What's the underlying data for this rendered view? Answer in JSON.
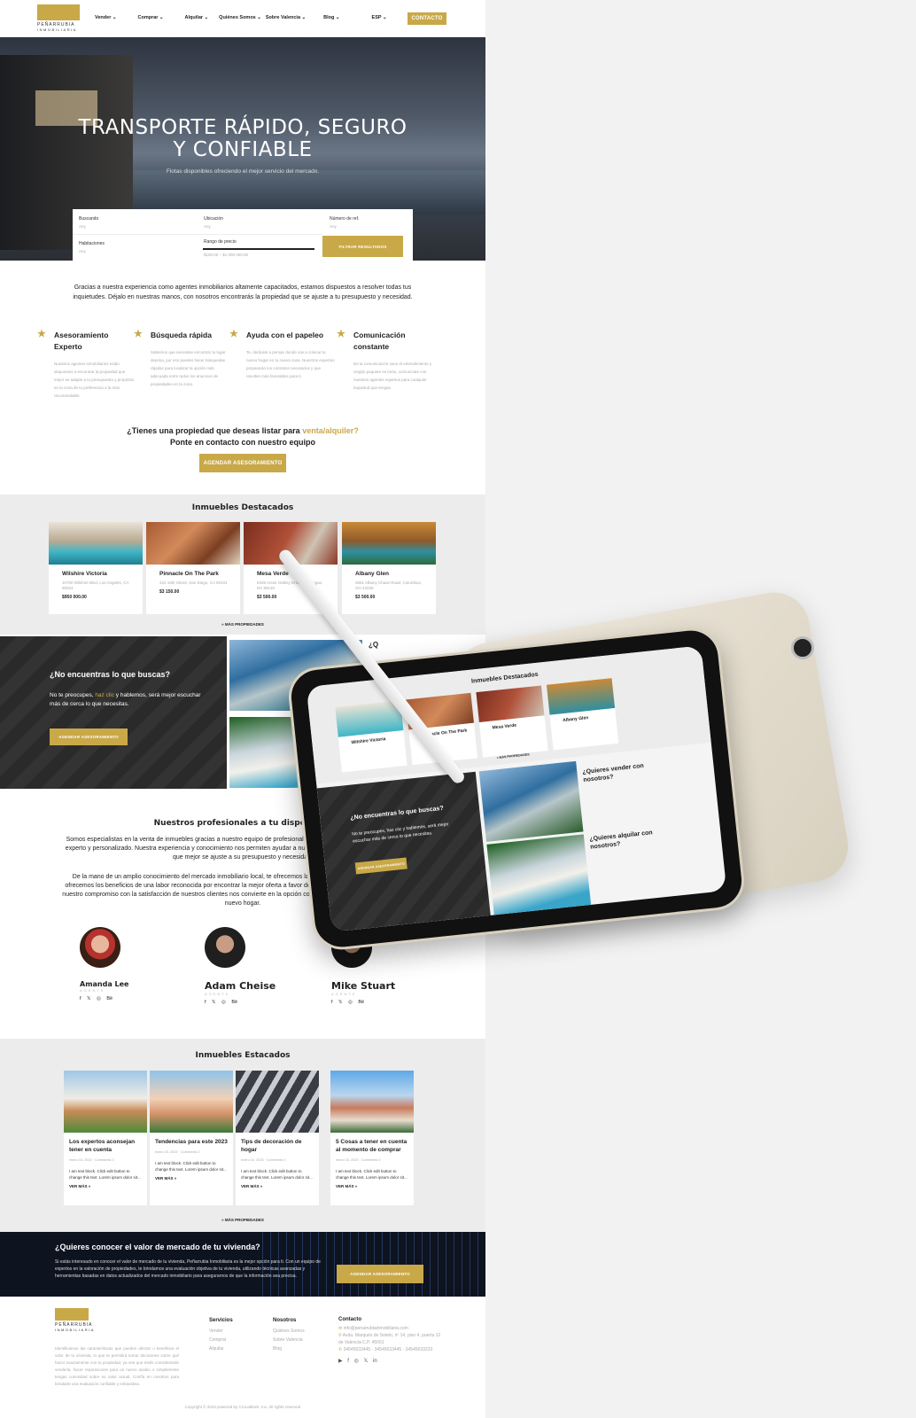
{
  "nav": {
    "logo_line1": "PEÑARRUBIA",
    "logo_line2": "INMOBILIARIA",
    "items": [
      "Vender ⌄",
      "Comprar ⌄",
      "Alquilar ⌄",
      "Quiénes Somos ⌄",
      "Sobre Valencia ⌄",
      "Blog ⌄",
      "ESP ⌄"
    ],
    "contact": "CONTACTO"
  },
  "hero": {
    "title_line1": "TRANSPORTE RÁPIDO, SEGURO",
    "title_line2": "Y CONFIABLE",
    "subtitle": "Flotas disponibles ofreciendo el mejor servicio del mercado."
  },
  "search": {
    "f1_label": "Buscando",
    "f1_value": "Any",
    "f2_label": "Ubicación",
    "f2_value": "Any",
    "f3_label": "Número de ref.",
    "f3_value": "Any",
    "f4_label": "Habitaciones",
    "f4_value": "Any",
    "range_label": "Rango de precio",
    "range_value": "$100.00 – $1 000 000.00",
    "filter_button": "FILTRAR RESULTADOS"
  },
  "intro": "Gracias a nuestra experiencia como agentes inmobiliarios altamente capacitados, estamos dispuestos a resolver todas tus inquietudes. Déjalo en nuestras manos, con nosotros encontrarás la propiedad que se ajuste a tu presupuesto y necesidad.",
  "features": [
    {
      "title": "Asesoramiento Experto",
      "text": "Nuestros agentes inmobiliarios están dispuestos a encontrar la propiedad que mejor se adapte a tu presupuesto y propósito en la zona de tu preferencia o la más recomendable."
    },
    {
      "title": "Búsqueda rápida",
      "text": "Sabemos que necesitas encontrar tu lugar deprisa, por eso puedes hacer búsquedas rápidas para localizar la opción más adecuada entre todos los anuncios de propiedades en la zona."
    },
    {
      "title": "Ayuda con el papeleo",
      "text": "Te, dedicate a pensar donde vas a colocar tu nuevo hogar en tu nueva casa. Nuestros expertos prepararán los contratos necesarios y que resulten más favorables para ti."
    },
    {
      "title": "Comunicación constante",
      "text": "De la comunicación nace el entendimiento y ningún paquete es tonto, comunícate con nuestros agentes expertos para cualquier inquietud que tengas."
    }
  ],
  "listing_cta": {
    "line1_a": "¿Tienes una propiedad que deseas listar para ",
    "line1_b": "venta/alquiler?",
    "line2": "Ponte en contacto con nuestro equipo",
    "button": "AGENDAR ASESORAMIENTO"
  },
  "featured": {
    "title": "Inmuebles Destacados",
    "cards": [
      {
        "name": "Wilshire Victoria",
        "address": "10700 Wilshire Blvd, Los Angeles, CA 90024",
        "price": "$950 000.00"
      },
      {
        "name": "Pinnacle On The Park",
        "address": "424 15th Street, San Diego, CA 92101",
        "price": "$3 150.00"
      },
      {
        "name": "Mesa Verde",
        "address": "6335 Annie Oakley Drive, Las Vegas, NV 89120",
        "price": "$3 500.00"
      },
      {
        "name": "Albany Glen",
        "address": "3651 Albany Chase Road, Columbus, OH 43230",
        "price": "$3 500.00"
      }
    ],
    "more": "» MÁS PROPIEDADES"
  },
  "dark_block": {
    "title": "¿No encuentras lo que buscas?",
    "text_a": "No te preocupes, ",
    "text_link": "haz clic",
    "text_b": " y hablemos, será mejor escuchar más de cerca lo que necesitas.",
    "button": "AGENDAR ASESORAMIENTO",
    "peek": "¿Q"
  },
  "pros": {
    "title": "Nuestros profesionales a tu disposición",
    "p1": "Somos especialistas en la venta de inmuebles gracias a nuestro equipo de profesionales, enfocados en brindarte asesoramiento experto y personalizado. Nuestra experiencia y conocimiento nos permiten ayudar a nuestros clientes para encontrar el inmueble que mejor se ajuste a su presupuesto y necesidad.",
    "p2": "De la mano de un amplio conocimiento del mercado inmobiliario local, te ofrecemos las mejores propiedades disponibles, te ofrecemos los beneficios de una labor reconocida por encontrar la mejor oferta a favor de todas las partes involucradas. Además, nuestro compromiso con la satisfacción de nuestros clientes nos convierte en la opción confiable y experta para quienes buscan un nuevo hogar.",
    "agents": [
      {
        "name": "Amanda Lee",
        "role": "AGENTE"
      },
      {
        "name": "Adam Cheise",
        "role": "AGENTE"
      },
      {
        "name": "Mike Stuart",
        "role": "AGENTE"
      }
    ],
    "social": "f 𝕏 ◎ Bē"
  },
  "blog": {
    "title": "Inmuebles Estacados",
    "posts": [
      {
        "title": "Los expertos aconsejan tener en cuenta",
        "meta": "enero 15, 2023 · Comments 0",
        "excerpt": "I am text block. Click edit button to change this text. Lorem ipsum dolor sit...",
        "read": "VER MÁS »"
      },
      {
        "title": "Tendencias para este 2023",
        "meta": "enero 15, 2023 · Comments 0",
        "excerpt": "I am text block. Click edit button to change this text. Lorem ipsum dolor sit...",
        "read": "VER MÁS »"
      },
      {
        "title": "Tips de decoración de hogar",
        "meta": "enero 15, 2023 · Comments 0",
        "excerpt": "I am text block. Click edit button to change this text. Lorem ipsum dolor sit...",
        "read": "VER MÁS »"
      },
      {
        "title": "5 Cosas a tener en cuenta al momento de comprar",
        "meta": "enero 15, 2023 · Comments 0",
        "excerpt": "I am text block. Click edit button to change this text. Lorem ipsum dolor sit...",
        "read": "VER MÁS »"
      }
    ],
    "more": "» MÁS PROPIEDADES"
  },
  "value_cta": {
    "title": "¿Quieres conocer el valor de mercado de tu vivienda?",
    "text": "Si estás interesado en conocer el valor de mercado de tu vivienda, Peñarrubia Inmobiliaria es la mejor opción para ti. Con un equipo de expertos en la valoración de propiedades, te brindamos una evaluación objetiva de tu vivienda, utilizando técnicas avanzadas y herramientas basadas en datos actualizados del mercado inmobiliario para asegurarnos de que la información sea precisa.",
    "button": "AGENDAR ASESORAMIENTO"
  },
  "footer": {
    "about": "Identificamos las características que pueden afectar o beneficiar el valor de tu vivienda, lo que te permitirá tomar decisiones sobre qué hacer exactamente con tu propiedad, ya sea que estés considerando venderla, hacer reparaciones para un nuevo avalúo o simplemente tengas curiosidad sobre su valor actual. Confía en nosotros para brindarte una evaluación confiable y exhaustiva.",
    "services_title": "Servicios",
    "services": [
      "Vender",
      "Comprar",
      "Alquilar"
    ],
    "about_title": "Nosotros",
    "about_links": [
      "Quiénes Somos",
      "Sobre Valencia",
      "Blog"
    ],
    "contact_title": "Contacto",
    "email": "info@penarrubiainmobiliaria.com",
    "address": "Avda. Marqués de Sotelo, nº 14, piso 4, puerta 12 de Valencia C.P. 45001",
    "phones": "34545633445 - 34545633445 - 34545633223",
    "social": "▶ f ◎ 𝕏 in",
    "copyright": "Copyright © 2023 powered by CrocoBlock. Inc. All rights reserved"
  },
  "tablet": {
    "title": "Inmuebles Destacados",
    "cards": [
      "Wilshire Victoria",
      "Pinnacle On The Park",
      "Mesa Verde",
      "Albany Glen"
    ],
    "more": "» MÁS PROPIEDADES",
    "dark_title": "¿No encuentras lo que buscas?",
    "dark_text": "No te preocupes, haz clic y hablemos, será mejor escuchar más de cerca lo que necesitas.",
    "button": "AGENDAR ASESORAMIENTO",
    "q1": "¿Quieres vender con nosotros?",
    "q2": "¿Quieres alquilar con nosotros?"
  },
  "colors": {
    "accent": "#c9a848",
    "dark": "#2a2a2a",
    "band": "#0e1320"
  }
}
